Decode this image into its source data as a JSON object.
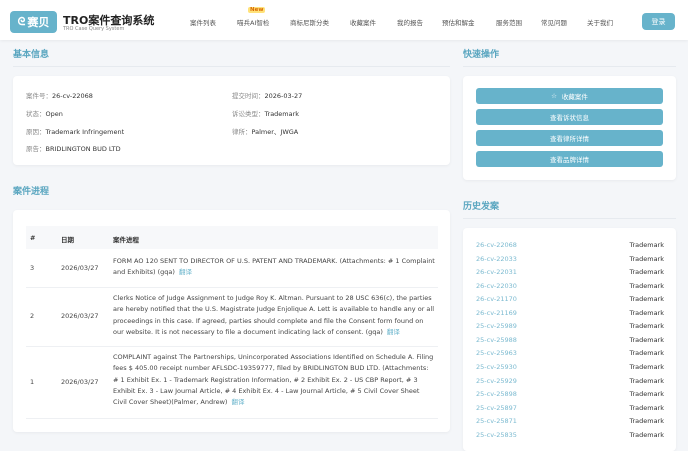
{
  "header": {
    "logo_text": "赛贝",
    "title": "TRO案件查询系统",
    "subtitle": "TRO Case Query System",
    "nav": [
      "案件列表",
      "喵兵AI智检",
      "商标尼斯分类",
      "收藏案件",
      "我的报告",
      "预估和解金",
      "服务范围",
      "常见问题",
      "关于我们"
    ],
    "new_badge": "New",
    "login": "登录"
  },
  "basic_info": {
    "title": "基本信息",
    "case_no_label": "案件号：",
    "case_no": "26-cv-22068",
    "submit_label": "提交时间：",
    "submit": "2026-03-27",
    "status_label": "状态：",
    "status": "Open",
    "type_label": "诉讼类型：",
    "type": "Trademark",
    "cause_label": "原因：",
    "cause": "Trademark Infringement",
    "firm_label": "律所：",
    "firm": "Palmer、JWGA",
    "plaintiff_label": "原告：",
    "plaintiff": "BRIDLINGTON BUD LTD"
  },
  "progress": {
    "title": "案件进程",
    "headers": [
      "#",
      "日期",
      "案件进程"
    ],
    "translate": "翻译",
    "rows": [
      {
        "n": "3",
        "date": "2026/03/27",
        "text": "FORM AO 120 SENT TO DIRECTOR OF U.S. PATENT AND TRADEMARK. (Attachments: # 1 Complaint and Exhibits) (gqa)"
      },
      {
        "n": "2",
        "date": "2026/03/27",
        "text": "Clerks Notice of Judge Assignment to Judge Roy K. Altman. Pursuant to 28 USC 636(c), the parties are hereby notified that the U.S. Magistrate Judge Enjolique A. Lett is available to handle any or all proceedings in this case. If agreed, parties should complete and file the Consent form found on our website. It is not necessary to file a document indicating lack of consent. (gqa)"
      },
      {
        "n": "1",
        "date": "2026/03/27",
        "text": "COMPLAINT against The Partnerships, Unincorporated Associations Identified on Schedule A. Filing fees $ 405.00 receipt number AFLSDC-19359777, filed by BRIDLINGTON BUD LTD. (Attachments: # 1 Exhibit Ex. 1 - Trademark Registration Information, # 2 Exhibit Ex. 2 - US CBP Report, # 3 Exhibit Ex. 3 - Law Journal Article, # 4 Exhibit Ex. 4 - Law Journal Article, # 5 Civil Cover Sheet Civil Cover Sheet)(Palmer, Andrew)"
      }
    ]
  },
  "quick": {
    "title": "快速操作",
    "buttons": [
      "收藏案件",
      "查看诉状信息",
      "查看律所详情",
      "查看品牌详情"
    ]
  },
  "history": {
    "title": "历史发案",
    "items": [
      {
        "case": "26-cv-22068",
        "type": "Trademark"
      },
      {
        "case": "26-cv-22033",
        "type": "Trademark"
      },
      {
        "case": "26-cv-22031",
        "type": "Trademark"
      },
      {
        "case": "26-cv-22030",
        "type": "Trademark"
      },
      {
        "case": "26-cv-21170",
        "type": "Trademark"
      },
      {
        "case": "26-cv-21169",
        "type": "Trademark"
      },
      {
        "case": "25-cv-25989",
        "type": "Trademark"
      },
      {
        "case": "25-cv-25988",
        "type": "Trademark"
      },
      {
        "case": "25-cv-25963",
        "type": "Trademark"
      },
      {
        "case": "25-cv-25930",
        "type": "Trademark"
      },
      {
        "case": "25-cv-25929",
        "type": "Trademark"
      },
      {
        "case": "25-cv-25898",
        "type": "Trademark"
      },
      {
        "case": "25-cv-25897",
        "type": "Trademark"
      },
      {
        "case": "25-cv-25871",
        "type": "Trademark"
      },
      {
        "case": "25-cv-25835",
        "type": "Trademark"
      }
    ]
  }
}
